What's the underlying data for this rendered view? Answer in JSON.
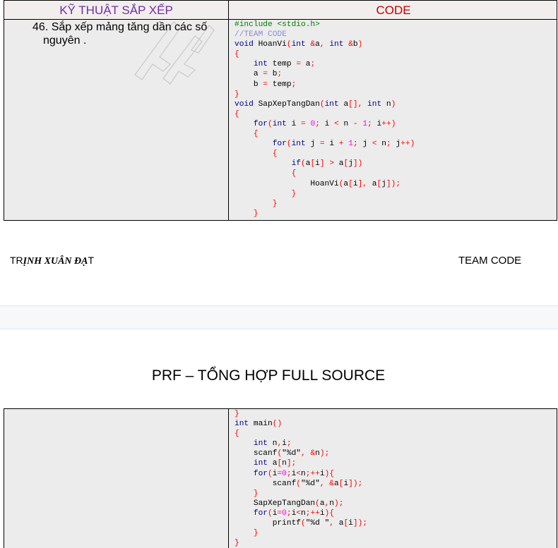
{
  "table1": {
    "header_left": "KỸ THUẬT SẮP XẾP",
    "header_right": "CODE",
    "question_number": "46.",
    "question_line1": "Sắp xếp mảng tăng dần các số",
    "question_line2": "nguyên ."
  },
  "code1": [
    "#include <stdio.h>",
    "//TEAM CODE",
    "void HoanVi(int &a, int &b)",
    "{",
    "    int temp = a;",
    "    a = b;",
    "    b = temp;",
    "}",
    "void SapXepTangDan(int a[], int n)",
    "{",
    "    for(int i = 0; i < n - 1; i++)",
    "    {",
    "        for(int j = i + 1; j < n; j++)",
    "        {",
    "            if(a[i] > a[j])",
    "            {",
    "                HoanVi(a[i], a[j]);",
    "            }",
    "        }",
    "    }"
  ],
  "footer": {
    "author_prefix": "TR",
    "author_italic": "ỊNH XUÂN ĐẠ",
    "author_suffix": "T",
    "team": "TEAM CODE"
  },
  "page_title": "PRF – TỔNG HỢP FULL SOURCE",
  "code2": [
    "}",
    "int main()",
    "{",
    "    int n,i;",
    "    scanf(\"%d\", &n);",
    "    int a[n];",
    "    for(i=0;i<n;++i){",
    "        scanf(\"%d\", &a[i]);",
    "    }",
    "    SapXepTangDan(a,n);",
    "    for(i=0;i<n;++i){",
    "        printf(\"%d \", a[i]);",
    "    }",
    "}"
  ]
}
